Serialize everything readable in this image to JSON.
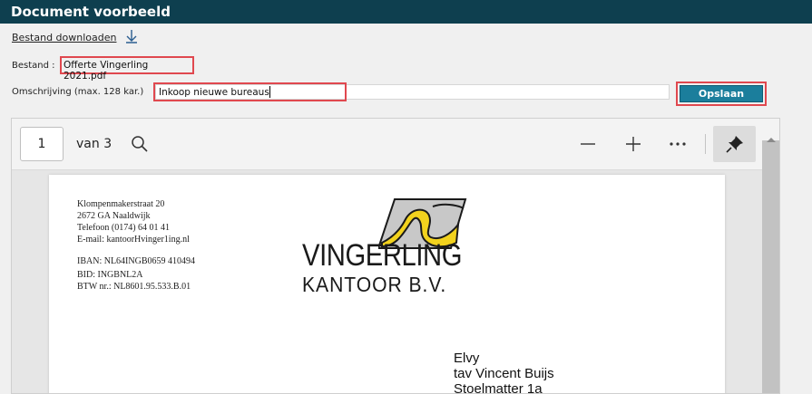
{
  "window": {
    "title": "Document voorbeeld"
  },
  "download": {
    "label": "Bestand downloaden",
    "icon": "download-arrow-icon"
  },
  "file": {
    "label": "Bestand :",
    "name": "Offerte Vingerling 2021.pdf"
  },
  "description": {
    "label": "Omschrijving (max. 128 kar.)",
    "value": "Inkoop nieuwe bureaus"
  },
  "save_button": {
    "label": "Opslaan",
    "color": "#1b7e9c"
  },
  "highlight_color": "#e0484f",
  "viewer": {
    "page_number": "1",
    "page_total_label": "van 3",
    "icons": [
      "search-icon",
      "zoom-out-icon",
      "zoom-in-icon",
      "more-options-icon",
      "pin-icon"
    ]
  },
  "document": {
    "sender": {
      "street": "Klompenmakerstraat 20",
      "city": "2672 GA Naaldwijk",
      "phone": "Telefoon (0174) 64 01 41",
      "email": "E-mail: kantoorHvinger1ing.nl",
      "iban": "IBAN: NL64INGB0659 410494",
      "bic": "BID: INGBNL2A",
      "btw": "BTW nr.: NL8601.95.533.B.01"
    },
    "brand": {
      "name": "VINGERLING",
      "sub": "KANTOOR B.V."
    },
    "recipient": {
      "line1": "Elvy",
      "line2": "tav Vincent Buijs",
      "line3": "Stoelmatter 1a"
    }
  }
}
